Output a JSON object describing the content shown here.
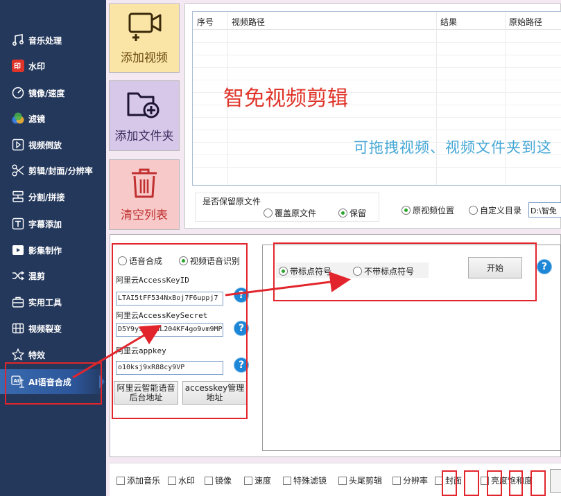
{
  "sidebar": {
    "items": [
      {
        "label": "音乐处理"
      },
      {
        "label": "水印"
      },
      {
        "label": "镜像/速度"
      },
      {
        "label": "滤镜"
      },
      {
        "label": "视频倒放"
      },
      {
        "label": "剪辑/封面/分辨率"
      },
      {
        "label": "分割/拼接"
      },
      {
        "label": "字幕添加"
      },
      {
        "label": "影集制作"
      },
      {
        "label": "混剪"
      },
      {
        "label": "实用工具"
      },
      {
        "label": "视频裂变"
      },
      {
        "label": "特效"
      },
      {
        "label": "AI语音合成"
      }
    ],
    "active": "AI语音合成"
  },
  "actions": {
    "add_video": "添加视频",
    "add_folder": "添加文件夹",
    "clear_list": "清空列表"
  },
  "table": {
    "columns": [
      "序号",
      "视频路径",
      "结果",
      "原始路径"
    ],
    "watermark": "智免视频剪辑",
    "drag_hint": "可拖拽视频、视频文件夹到这"
  },
  "keep_original": {
    "title": "是否保留原文件",
    "options": [
      "覆盖原文件",
      "保留"
    ],
    "selected": "保留"
  },
  "output": {
    "options": [
      "原视频位置",
      "自定义目录"
    ],
    "selected": "原视频位置",
    "path_value": "D:\\智免"
  },
  "ai_panel": {
    "modes": [
      "语音合成",
      "视频语音识别"
    ],
    "selected_mode": "视频语音识别",
    "access_key_id_label": "阿里云AccessKeyID",
    "access_key_id_value": "LTAI5tFF534NxBoj7F6uppj7",
    "access_key_secret_label": "阿里云AccessKeySecret",
    "access_key_secret_value": "D5Y9ysaasaL204KF4go9vm9MP",
    "appkey_label": "阿里云appkey",
    "appkey_value": "o10ksj9xR88cy9VP",
    "console_button": "阿里云智能语音后台地址",
    "console_line1": "阿里云智能语音",
    "console_line2": "后台地址",
    "key_mgmt_line1": "accesskey管理",
    "key_mgmt_line2": "地址",
    "help_mark": "?"
  },
  "recognition": {
    "punct_options": [
      "带标点符号",
      "不带标点符号"
    ],
    "selected": "带标点符号",
    "start_button": "开始"
  },
  "bottom_tabs": [
    "添加音乐",
    "水印",
    "镜像",
    "速度",
    "特殊滤镜",
    "头尾剪辑",
    "分辨率",
    "封面",
    "亮度饱和度"
  ],
  "colors": {
    "sidebar_bg": "#24385c",
    "annotation_red": "#e2252c",
    "radio_selected": "#2aa52a",
    "help_blue": "#1e86d6"
  }
}
